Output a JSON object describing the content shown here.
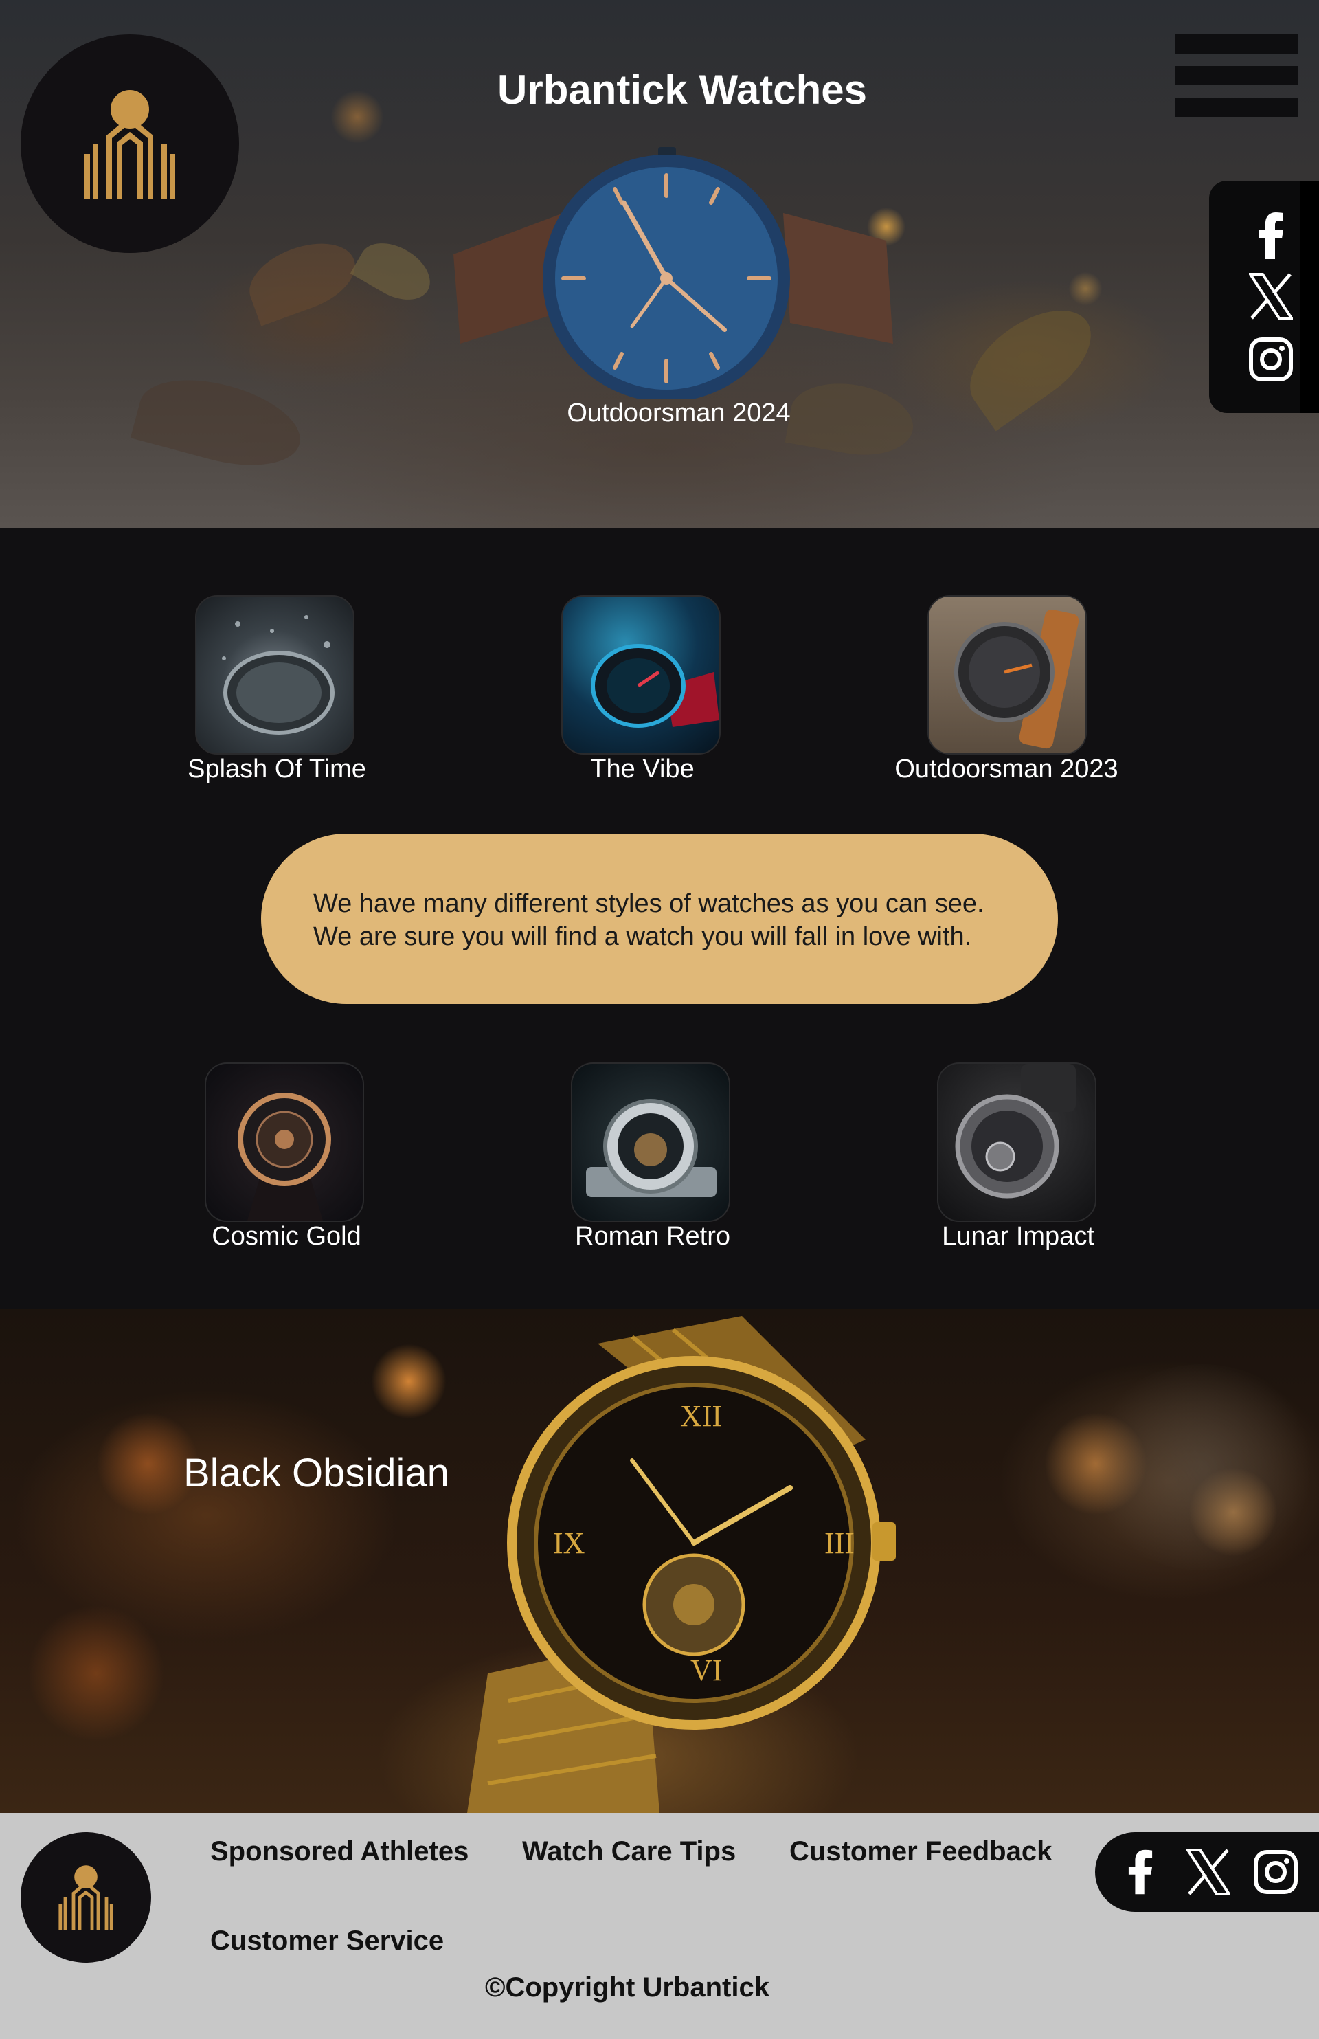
{
  "header": {
    "title": "Urbantick Watches",
    "hero_caption": "Outdoorsman 2024",
    "logo_icon": "urbantick-logo-icon",
    "menu_icon": "hamburger-menu-icon"
  },
  "social": {
    "items": [
      {
        "name": "Facebook",
        "icon": "facebook-icon"
      },
      {
        "name": "X",
        "icon": "x-icon"
      },
      {
        "name": "Instagram",
        "icon": "instagram-icon"
      }
    ]
  },
  "gallery": {
    "row1": [
      {
        "label": "Splash Of Time"
      },
      {
        "label": "The Vibe"
      },
      {
        "label": "Outdoorsman 2023"
      }
    ],
    "intro_lines": [
      "We have many different styles of watches as you can see.",
      "We are sure you will find a watch you will fall in love with."
    ],
    "row2": [
      {
        "label": "Cosmic Gold"
      },
      {
        "label": "Roman Retro"
      },
      {
        "label": "Lunar Impact"
      }
    ]
  },
  "feature": {
    "title": "Black Obsidian"
  },
  "footer": {
    "links": [
      "Sponsored Athletes",
      "Watch Care Tips",
      "Customer Feedback",
      "Customer Service"
    ],
    "copyright": "©Copyright Urbantick"
  },
  "colors": {
    "page_bg": "#111012",
    "accent_gold": "#e0b878",
    "logo_gold": "#c9974a",
    "footer_bg": "#c8c8c8"
  }
}
